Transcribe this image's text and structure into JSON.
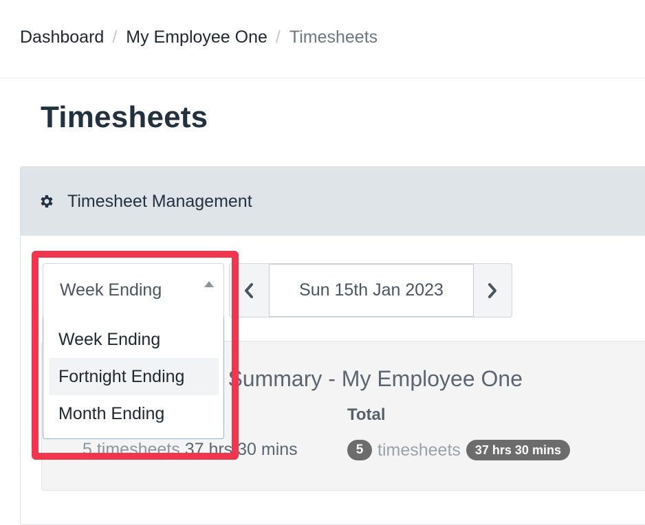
{
  "breadcrumb": {
    "items": [
      "Dashboard",
      "My Employee One",
      "Timesheets"
    ]
  },
  "page": {
    "title": "Timesheets"
  },
  "panel": {
    "header_title": "Timesheet Management",
    "header_icon": "gear-icon"
  },
  "period_select": {
    "value": "Week Ending",
    "options": [
      "Week Ending",
      "Fortnight Ending",
      "Month Ending"
    ],
    "hovered_option": "Fortnight Ending"
  },
  "date_pager": {
    "date": "Sun 15th Jan 2023",
    "prev_icon": "chevron-left-icon",
    "next_icon": "chevron-right-icon"
  },
  "summary": {
    "title": "Timesheet Summary - My Employee One",
    "left": {
      "count_text": "5 timesheets",
      "hours_text": "37 hrs 30 mins"
    },
    "total": {
      "label": "Total",
      "count": "5",
      "count_suffix": "timesheets",
      "hours": "37 hrs 30 mins"
    }
  },
  "colors": {
    "highlight": "#f0354d",
    "panel_header_bg": "#dfe4e8",
    "badge_bg": "#6c6c6c",
    "dropdown_border": "#8fb4dc"
  }
}
